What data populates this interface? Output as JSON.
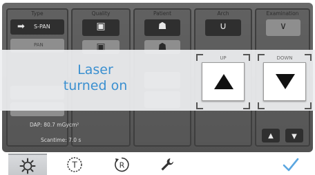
{
  "header": {
    "type": "Type",
    "quality": "Quality",
    "patient": "Patient",
    "arch": "Arch",
    "examination": "Examination"
  },
  "type_panel": {
    "selected_mode": "S-PAN",
    "secondary_mode": "PAN"
  },
  "readouts": {
    "dap": "DAP: 80.7 mGycm²",
    "scantime": "Scantime: 7.0 s"
  },
  "popup": {
    "message_line1": "Laser",
    "message_line2": "turned on",
    "up_label": "UP",
    "down_label": "DOWN"
  },
  "tabs": [
    {
      "name": "settings",
      "icon": "gear-icon"
    },
    {
      "name": "test",
      "icon": "t-circle-icon",
      "letter": "T"
    },
    {
      "name": "reset",
      "icon": "r-circle-arrow-icon",
      "letter": "R"
    },
    {
      "name": "tools",
      "icon": "wrench-icon"
    },
    {
      "name": "confirm",
      "icon": "checkmark-icon"
    }
  ],
  "colors": {
    "message": "#3a8fd0",
    "check": "#5aa6e0",
    "popup_bg": "#eeeff1",
    "panel_bg": "#5e5e5e"
  }
}
